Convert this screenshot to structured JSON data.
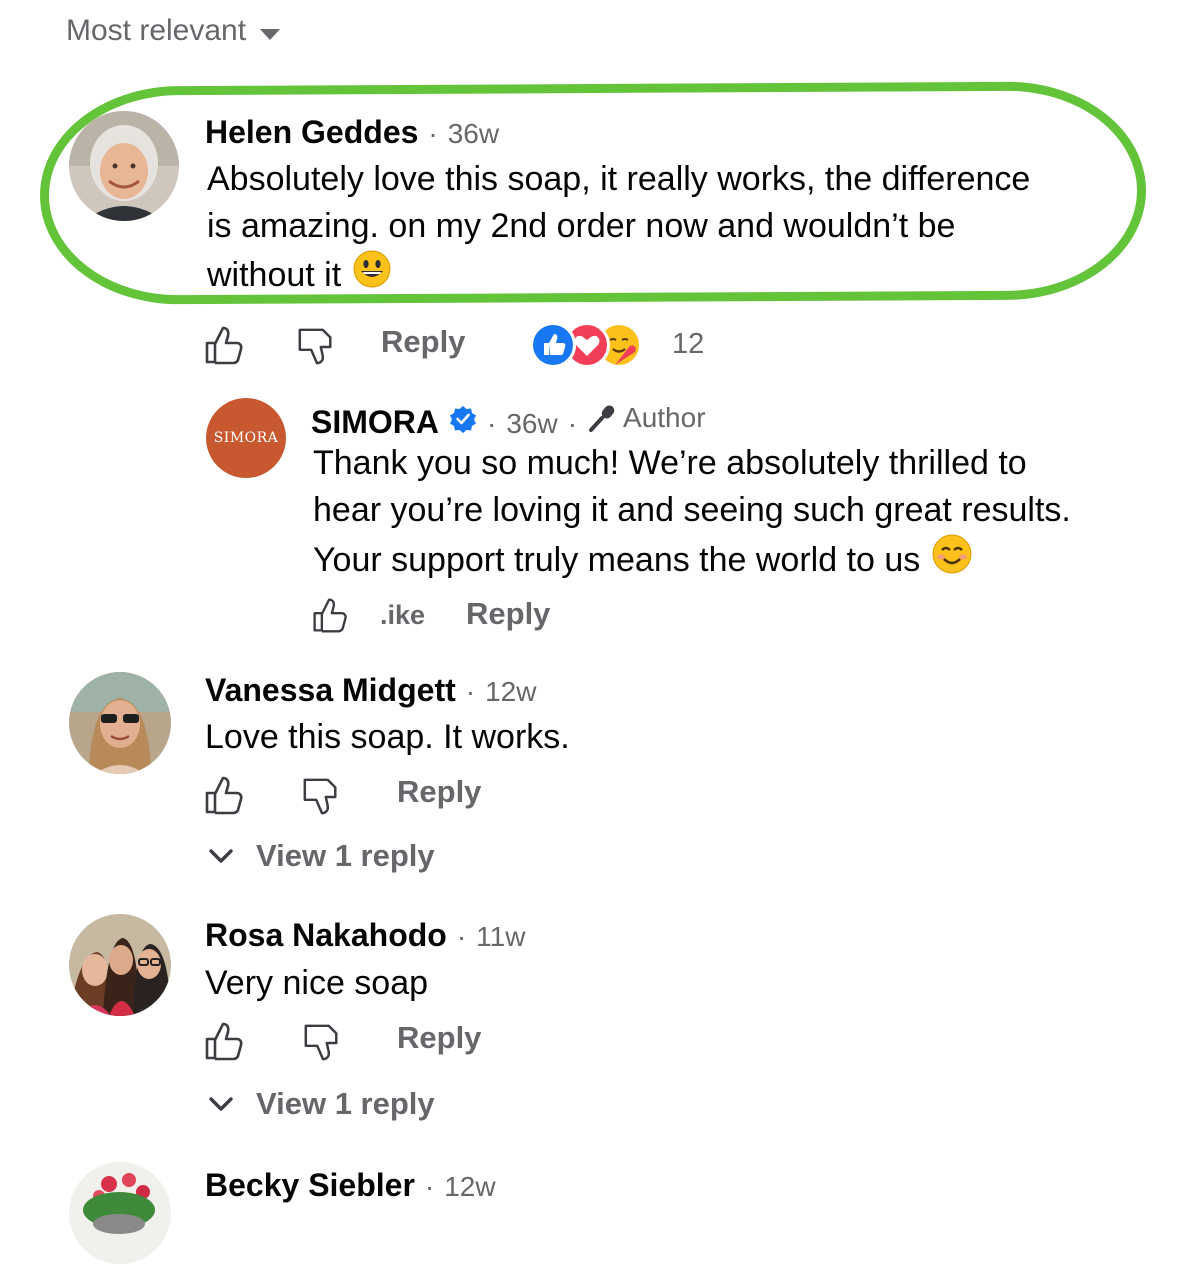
{
  "sort": {
    "label": "Most relevant"
  },
  "comments": [
    {
      "author": "Helen Geddes",
      "time": "36w",
      "text_lines": [
        "Absolutely love this soap, it really works, the difference",
        "is amazing. on my 2nd order now and wouldn’t be",
        "without it"
      ],
      "emoji": "grinning-face",
      "actions": {
        "reply": "Reply"
      },
      "reactions": {
        "count": "12",
        "types": [
          "like",
          "love",
          "care"
        ]
      },
      "highlighted": true
    },
    {
      "author": "SIMORA",
      "avatar_text": "SIMORA",
      "verified": true,
      "time": "36w",
      "badge": "Author",
      "text_lines": [
        "Thank you so much! We’re absolutely thrilled to",
        "hear you’re loving it and seeing such great results.",
        "Your support truly means the world to us"
      ],
      "emoji": "smiling-face",
      "actions": {
        "like": ".ike",
        "reply": "Reply"
      },
      "is_reply": true
    },
    {
      "author": "Vanessa Midgett",
      "time": "12w",
      "text_lines": [
        "Love this soap. It works."
      ],
      "actions": {
        "reply": "Reply"
      },
      "view_replies": "View 1 reply"
    },
    {
      "author": "Rosa Nakahodo",
      "time": "11w",
      "text_lines": [
        "Very nice soap"
      ],
      "actions": {
        "reply": "Reply"
      },
      "view_replies": "View 1 reply"
    },
    {
      "author": "Becky Siebler",
      "time": "12w"
    }
  ],
  "colors": {
    "highlight": "#63c43a",
    "muted": "#65676b",
    "like_blue": "#1877f2",
    "love_red": "#f33e58",
    "simora_brand": "#c8582f"
  }
}
